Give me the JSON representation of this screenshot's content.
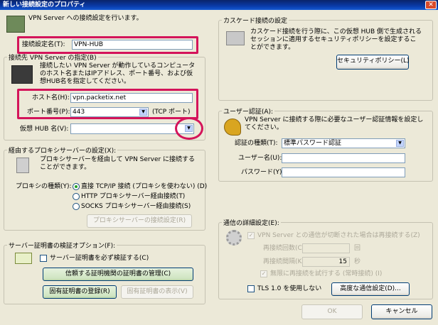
{
  "window": {
    "title": "新しい接続設定のプロパティ",
    "close_glyph": "✕"
  },
  "intro": {
    "text": "VPN Server への接続設定を行います。"
  },
  "connection_name": {
    "label": "接続設定名(T):",
    "value": "VPN-HUB"
  },
  "server_group": {
    "legend": "接続先 VPN Server の指定(B)",
    "description": "接続したい VPN Server が動作しているコンピュータのホスト名またはIPアドレス、ポート番号、および仮想HUB名を指定してください。",
    "host_label": "ホスト名(H):",
    "host_value": "vpn.packetix.net",
    "port_label": "ポート番号(P):",
    "port_value": "443",
    "port_note": "(TCP ポート)",
    "hub_label": "仮想 HUB 名(V):",
    "hub_value": ""
  },
  "proxy_group": {
    "legend": "経由するプロキシサーバーの設定(X):",
    "description": "プロキシサーバーを経由して VPN Server に接続することができます。",
    "type_label": "プロキシの種類(Y):",
    "options": [
      "直接 TCP/IP 接続 (プロキシを使わない) (D)",
      "HTTP プロキシサーバー経由接続(T)",
      "SOCKS プロキシサーバー経由接続(S)"
    ],
    "selected": 0,
    "config_button": "プロキシサーバーの接続設定(R)"
  },
  "cert_group": {
    "legend": "サーバー証明書の検証オプション(F):",
    "verify_label": "サーバー証明書を必ず検証する(C)",
    "verify_checked": false,
    "trusted_ca_button": "信頼する証明機関の証明書の管理(C)",
    "register_button": "固有証明書の登録(R)",
    "view_button": "固有証明書の表示(V)"
  },
  "cascade_group": {
    "legend": "カスケード接続の設定",
    "description": "カスケード接続を行う際に、この仮想 HUB 側で生成されるセッションに適用するセキュリティポリシーを設定することができます。",
    "policy_button": "セキュリティポリシー(L)"
  },
  "auth_group": {
    "legend": "ユーザー認証(A):",
    "description": "VPN Server に接続する際に必要なユーザー認証情報を設定してください。",
    "type_label": "認証の種類(T):",
    "type_value": "標準パスワード認証",
    "user_label": "ユーザー名(U):",
    "user_value": "",
    "password_label": "パスワード(Y):",
    "password_value": ""
  },
  "comm_group": {
    "legend": "通信の詳細設定(E):",
    "reconnect_label": "VPN Server との通信が切断された場合は再接続する(Z)",
    "reconnect_checked": true,
    "count_label": "再接続回数(C):",
    "count_value": "",
    "count_unit": "回",
    "interval_label": "再接続間隔(K):",
    "interval_value": "15",
    "interval_unit": "秒",
    "infinite_label": "無限に再接続を試行する (常時接続) (I)",
    "infinite_checked": true,
    "tls_label": "TLS 1.0 を使用しない",
    "tls_checked": false,
    "advanced_button": "高度な通信設定(D)..."
  },
  "footer": {
    "ok": "OK",
    "cancel": "キャンセル"
  },
  "check_glyph": "✓",
  "arrow_glyph": "▼"
}
